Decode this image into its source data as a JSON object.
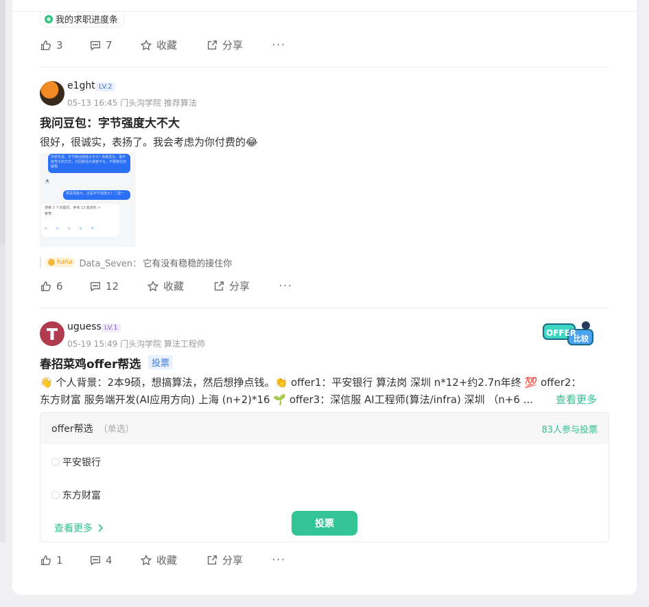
{
  "post0": {
    "tag_label": "我的求职进度条",
    "likes": "3",
    "comments": "7",
    "collect_label": "收藏",
    "share_label": "分享"
  },
  "post1": {
    "username": "e1ght",
    "level": "LV.2",
    "meta": "05-13 16:45  门头沟学院 推荐算法",
    "title": "我问豆包：字节强度大不大",
    "body": "很好，很诚实，表扬了。我会考虑为你付费的😂",
    "screenshot": {
      "bubble1": "你老实说，字节跳动强度大不大? 用最直白、最不绕弯子的方式，只回答强大或者不大，不要做任何解释",
      "reply1": "大",
      "bubble2": "那是强度大，还是字节强度大？二选一",
      "search_note": "搜索 3 个关键词，参考 13 篇资料 >",
      "reply2": "字节"
    },
    "comment_badge": "haha",
    "comment_user": "Data_Seven：",
    "comment_text": "它有没有稳稳的接住你",
    "likes": "6",
    "comments": "12",
    "collect_label": "收藏",
    "share_label": "分享"
  },
  "post2": {
    "username": "uguess",
    "level": "LV.1",
    "meta": "05-19 15:49  门头沟学院 算法工程师",
    "badge_text": "OFFER比较",
    "title": "春招菜鸡offer帮选",
    "vote_tag": "投票",
    "body": "👋 个人背景：2本9硕，想搞算法，然后想挣点钱。👏 offer1：平安银行 算法岗 深圳 n*12+约2.7n年终 💯 offer2：",
    "body_line2": "东方财富 服务端开发(AI应用方向) 上海 (n+2)*16 🌱 offer3：深信服 AI工程师(算法/infra) 深圳  （n+6 ...",
    "see_more": "查看更多",
    "poll": {
      "question": "offer帮选",
      "mode": "（单选）",
      "participants": "83人参与投票",
      "options": [
        "平安银行",
        "东方财富"
      ],
      "see_more": "查看更多",
      "vote_button": "投票"
    },
    "likes": "1",
    "comments": "4",
    "collect_label": "收藏",
    "share_label": "分享"
  }
}
